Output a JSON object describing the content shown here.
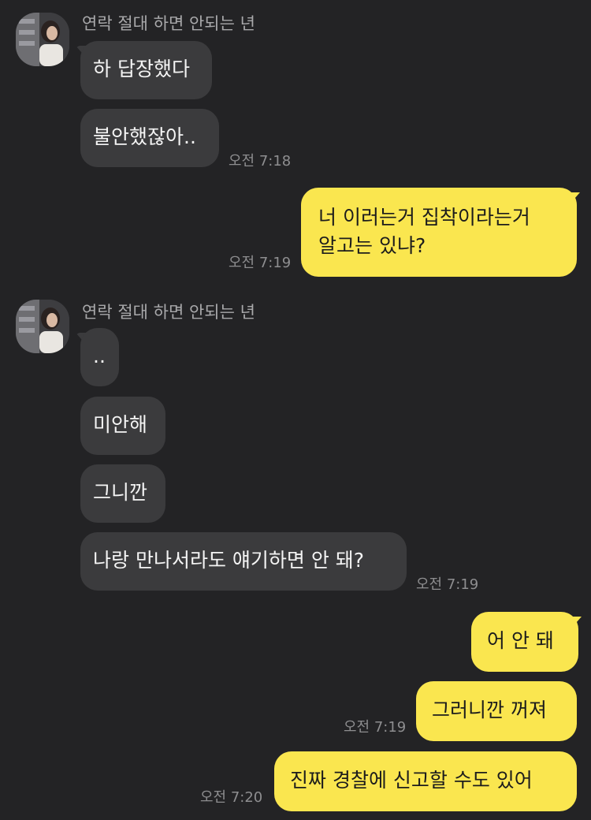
{
  "sender": {
    "name": "연락 절대 하면 안되는 년"
  },
  "theme": {
    "background": "#232325",
    "incoming_bubble": "#3b3b3d",
    "outgoing_bubble": "#fae64f"
  },
  "messages": [
    {
      "from": "them",
      "text": "하 답장했다"
    },
    {
      "from": "them",
      "text": "불안했잖아..",
      "time": "오전 7:18"
    },
    {
      "from": "me",
      "text": "너 이러는거 집착이라는거\n알고는 있냐?",
      "time": "오전 7:19"
    },
    {
      "from": "them",
      "text": ".."
    },
    {
      "from": "them",
      "text": "미안해"
    },
    {
      "from": "them",
      "text": "그니깐"
    },
    {
      "from": "them",
      "text": "나랑 만나서라도 얘기하면 안 돼?",
      "time": "오전 7:19"
    },
    {
      "from": "me",
      "text": "어 안 돼"
    },
    {
      "from": "me",
      "text": "그러니깐 꺼져",
      "time": "오전 7:19"
    },
    {
      "from": "me",
      "text": "진짜 경찰에 신고할 수도 있어",
      "time": "오전 7:20"
    }
  ]
}
